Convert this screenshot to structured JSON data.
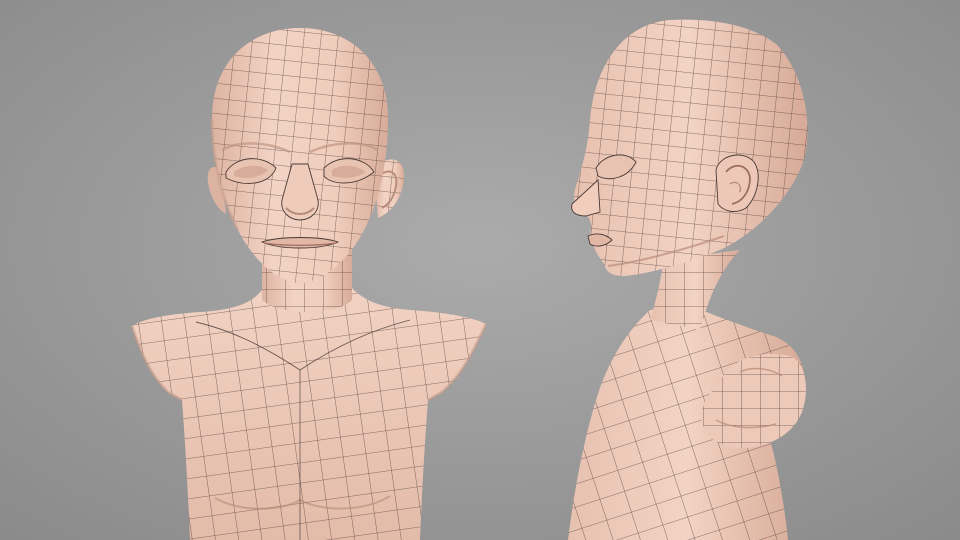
{
  "scene": {
    "views": [
      "front",
      "side"
    ],
    "colors": {
      "background_light": "#a9a9a9",
      "background_dark": "#898989",
      "skin": "#f0ccbc",
      "skin_shadow": "#d8ab98",
      "wire": "#4a3a36"
    }
  }
}
